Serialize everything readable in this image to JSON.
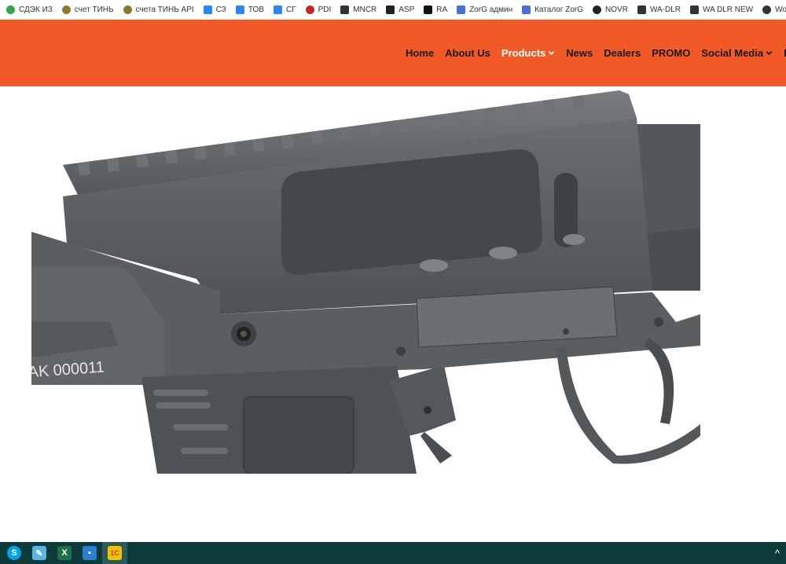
{
  "bookmarks": [
    {
      "label": "СДЭК ИЗ",
      "icon": "cdek-icon",
      "color": "#2ca84a"
    },
    {
      "label": "счет ТИНЬ",
      "icon": "tinkoff-icon",
      "color": "#8a7a30"
    },
    {
      "label": "счета ТИНЬ API",
      "icon": "tinkoff-icon",
      "color": "#8a7a30"
    },
    {
      "label": "СЗ",
      "icon": "vk-icon",
      "color": "#2787f5"
    },
    {
      "label": "ТОВ",
      "icon": "vk-icon",
      "color": "#2787f5"
    },
    {
      "label": "СГ",
      "icon": "chat-icon",
      "color": "#2787f5"
    },
    {
      "label": "PDI",
      "icon": "pdi-icon",
      "color": "#c62828"
    },
    {
      "label": "MNCR",
      "icon": "mncr-icon",
      "color": "#333333"
    },
    {
      "label": "ASP",
      "icon": "asp-icon",
      "color": "#222222"
    },
    {
      "label": "RA",
      "icon": "ra-icon",
      "color": "#111111"
    },
    {
      "label": "ZorG админ",
      "icon": "zorg-icon",
      "color": "#4a6fd8"
    },
    {
      "label": "Каталог ZorG",
      "icon": "zorg-icon",
      "color": "#4a6fd8"
    },
    {
      "label": "NOVR",
      "icon": "novr-icon",
      "color": "#222222"
    },
    {
      "label": "WA-DLR",
      "icon": "wa-icon",
      "color": "#333333"
    },
    {
      "label": "WA DLR NEW",
      "icon": "wa-icon",
      "color": "#333333"
    },
    {
      "label": "Wolverine Airsoft -...",
      "icon": "wolverine-icon",
      "color": "#333333"
    }
  ],
  "nav": {
    "items": [
      {
        "label": "Home",
        "active": false,
        "dropdown": false
      },
      {
        "label": "About Us",
        "active": false,
        "dropdown": false
      },
      {
        "label": "Products",
        "active": true,
        "dropdown": true
      },
      {
        "label": "News",
        "active": false,
        "dropdown": false
      },
      {
        "label": "Dealers",
        "active": false,
        "dropdown": false
      },
      {
        "label": "PROMO",
        "active": false,
        "dropdown": false
      },
      {
        "label": "Social Media",
        "active": false,
        "dropdown": true
      },
      {
        "label": "Belgiu",
        "active": false,
        "dropdown": false
      }
    ]
  },
  "product": {
    "serial": "AK 000011"
  },
  "colors": {
    "header": "#f15a27",
    "taskbar": "#0c3b3a",
    "gun_body": "#5d6063"
  },
  "taskbar": {
    "apps": [
      {
        "icon": "skype-icon",
        "glyph": "S",
        "color": "#00a2e8"
      },
      {
        "icon": "notepad-icon",
        "glyph": "✎",
        "color": "#5ab4e5"
      },
      {
        "icon": "excel-icon",
        "glyph": "X",
        "color": "#1e7145"
      },
      {
        "icon": "file-icon",
        "glyph": "▪",
        "color": "#2a7fd4"
      },
      {
        "icon": "1c-icon",
        "glyph": "1С",
        "color": "#f2c200"
      }
    ],
    "tray_glyph": "^"
  }
}
